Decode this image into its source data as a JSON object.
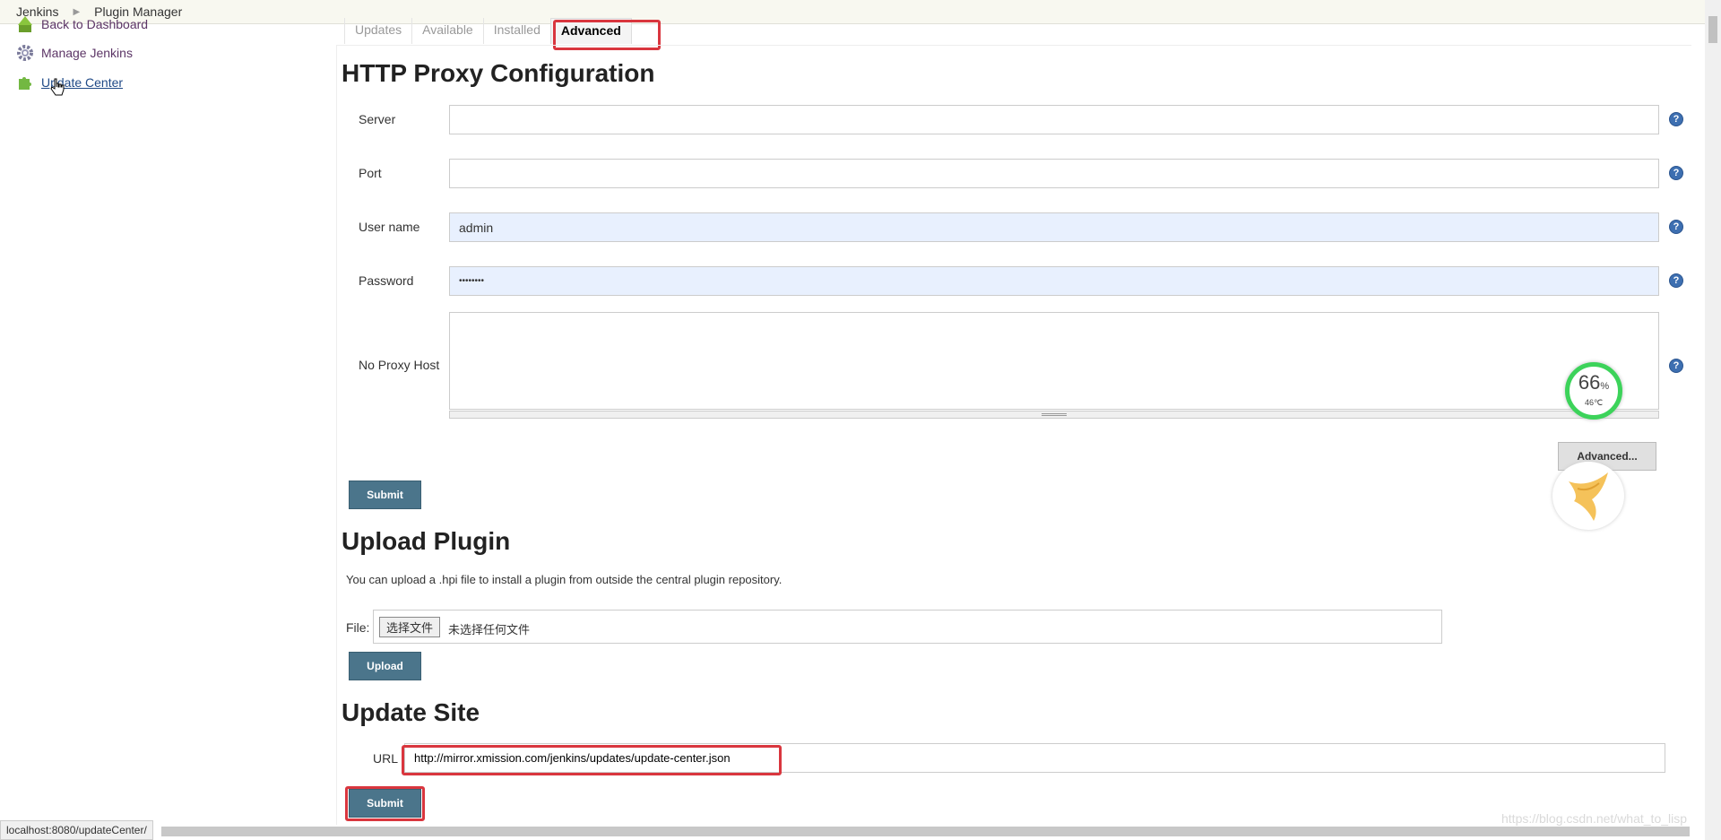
{
  "breadcrumb": {
    "root": "Jenkins",
    "current": "Plugin Manager"
  },
  "sidebar": {
    "items": [
      {
        "label": "Back to Dashboard",
        "icon": "arrow-up-icon"
      },
      {
        "label": "Manage Jenkins",
        "icon": "gear-icon"
      },
      {
        "label": "Update Center",
        "icon": "puzzle-icon"
      }
    ]
  },
  "tabs": [
    "Updates",
    "Available",
    "Installed",
    "Advanced"
  ],
  "proxy": {
    "title": "HTTP Proxy Configuration",
    "server_label": "Server",
    "server_value": "",
    "port_label": "Port",
    "port_value": "",
    "username_label": "User name",
    "username_value": "admin",
    "password_label": "Password",
    "password_value": "••••••••",
    "noproxy_label": "No Proxy Host",
    "noproxy_value": "",
    "advanced_button": "Advanced...",
    "submit_button": "Submit"
  },
  "upload": {
    "title": "Upload Plugin",
    "description": "You can upload a .hpi file to install a plugin from outside the central plugin repository.",
    "file_label": "File:",
    "choose_button": "选择文件",
    "no_file_text": "未选择任何文件",
    "upload_button": "Upload"
  },
  "update_site": {
    "title": "Update Site",
    "url_label": "URL",
    "url_value": "http://mirror.xmission.com/jenkins/updates/update-center.json",
    "submit_button": "Submit"
  },
  "widget": {
    "percent": "66",
    "unit": "%",
    "temp": "46℃"
  },
  "status_url": "localhost:8080/updateCenter/",
  "watermark": "https://blog.csdn.net/what_to_lisp",
  "colors": {
    "highlight": "#d9363e",
    "button": "#4b758b",
    "link": "#204a87"
  }
}
